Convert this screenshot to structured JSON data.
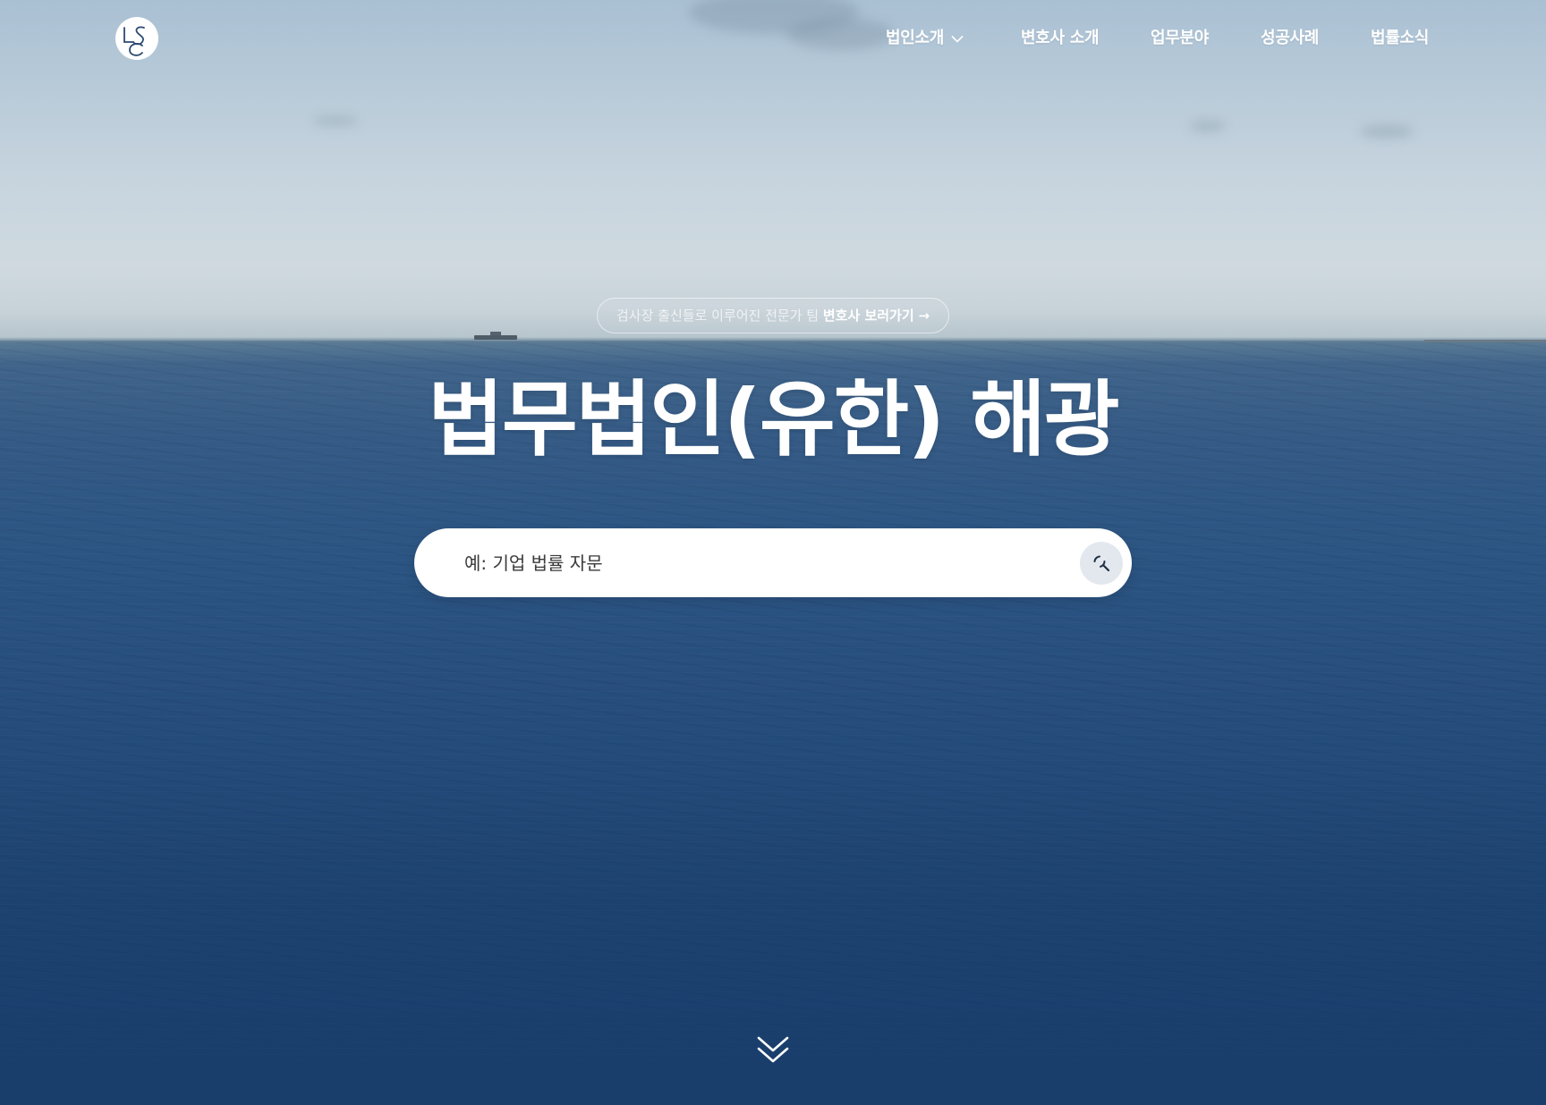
{
  "brand": {
    "logo_letters": "LSC"
  },
  "nav": {
    "items": [
      {
        "label": "법인소개",
        "has_dropdown": true
      },
      {
        "label": "변호사 소개",
        "has_dropdown": false
      },
      {
        "label": "업무분야",
        "has_dropdown": false
      },
      {
        "label": "성공사례",
        "has_dropdown": false
      },
      {
        "label": "법률소식",
        "has_dropdown": false
      }
    ]
  },
  "hero": {
    "pill": {
      "muted_text": "검사장 출신들로 이루어진 전문가 팀 ",
      "link_text": "변호사 보러가기",
      "arrow": "→"
    },
    "title": "법무법인(유한) 해광"
  },
  "search": {
    "placeholder": "예: 기업 법률 자문",
    "icon": "search-icon"
  },
  "scroll": {
    "icon": "double-chevron-down-icon"
  },
  "colors": {
    "sky": "#c9d6df",
    "sea": "#2c5583",
    "sea_deep": "#1a3e6c",
    "white": "#ffffff",
    "search_button": "#e3e8ee"
  }
}
